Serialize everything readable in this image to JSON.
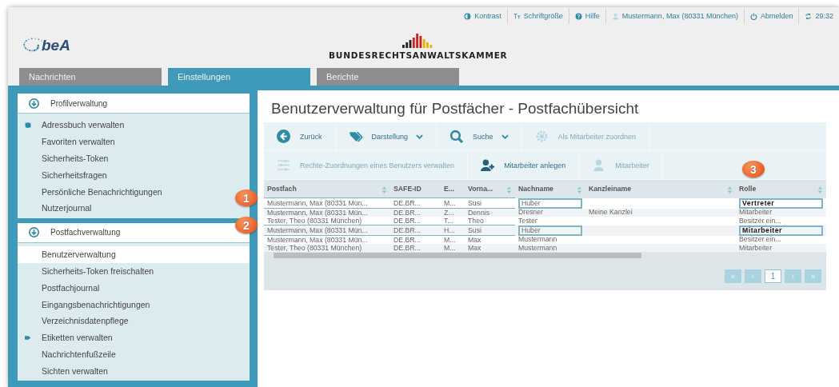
{
  "top_links": [
    {
      "kind": "contrast",
      "label": "Kontrast"
    },
    {
      "kind": "font",
      "label": "Schriftgröße"
    },
    {
      "kind": "help",
      "label": "Hilfe"
    },
    {
      "kind": "user",
      "label": "Mustermann, Max (80331 München)"
    },
    {
      "kind": "logout",
      "label": "Abmelden"
    },
    {
      "kind": "timer",
      "label": "29:32"
    }
  ],
  "logo": {
    "text": "beA"
  },
  "org": {
    "name": "BUNDESRECHTSANWALTSKAMMER"
  },
  "tabs": [
    {
      "label": "Nachrichten",
      "selected": false
    },
    {
      "label": "Einstellungen",
      "selected": true
    },
    {
      "label": "Berichte",
      "selected": false
    }
  ],
  "sidebar": [
    {
      "title": "Profilverwaltung",
      "items": [
        {
          "label": "Adressbuch verwalten",
          "kind": "book",
          "selected": false
        },
        {
          "label": "Favoriten verwalten",
          "selected": false
        },
        {
          "label": "Sicherheits-Token",
          "selected": false
        },
        {
          "label": "Sicherheitsfragen",
          "selected": false
        },
        {
          "label": "Persönliche Benachrichtigungen",
          "selected": false
        },
        {
          "label": "Nutzerjournal",
          "selected": false
        }
      ]
    },
    {
      "title": "Postfachverwaltung",
      "items": [
        {
          "label": "Benutzerverwaltung",
          "selected": true
        },
        {
          "label": "Sicherheits-Token freischalten",
          "selected": false
        },
        {
          "label": "Postfachjournal",
          "selected": false
        },
        {
          "label": "Eingangsbenachrichtigungen",
          "selected": false
        },
        {
          "label": "Verzeichnisdatenpflege",
          "selected": false
        },
        {
          "label": "Etiketten verwalten",
          "kind": "tag",
          "selected": false
        },
        {
          "label": "Nachrichtenfußzeile",
          "selected": false
        },
        {
          "label": "Sichten verwalten",
          "selected": false
        }
      ]
    }
  ],
  "page_title": "Benutzerverwaltung für Postfächer - Postfachübersicht",
  "toolbar": [
    [
      {
        "kind": "back",
        "label": "Zurück",
        "disabled": false,
        "dropdown": false
      },
      {
        "kind": "tags",
        "label": "Darstellung",
        "disabled": false,
        "dropdown": true
      },
      {
        "kind": "search",
        "label": "Suche",
        "disabled": false,
        "dropdown": true
      },
      {
        "kind": "gear",
        "label": "Als Mitarbeiter zuordnen",
        "disabled": true,
        "dropdown": false
      }
    ],
    [
      {
        "kind": "sliders",
        "label": "Rechte-Zuordnungen eines Benutzers verwalten",
        "disabled": true,
        "dropdown": false
      },
      {
        "kind": "user-add",
        "label": "Mitarbeiter anlegen",
        "disabled": false,
        "dropdown": false
      },
      {
        "kind": "user",
        "label": "Mitarbeiter",
        "disabled": true,
        "dropdown": false
      }
    ]
  ],
  "table": {
    "columns": [
      {
        "label": "Postfach",
        "sortable": true
      },
      {
        "label": "SAFE-ID",
        "sortable": false
      },
      {
        "label": "E...",
        "sortable": false
      },
      {
        "label": "Vorna...",
        "sortable": true
      },
      {
        "label": "Nachname",
        "sortable": true
      },
      {
        "label": "Kanzleiname",
        "sortable": true
      },
      {
        "label": "Rolle",
        "sortable": true,
        "callout": "3"
      }
    ],
    "rows": [
      {
        "cells": [
          "Mustermann, Max (80331 Mün...",
          "DE.BR...",
          "M...",
          "Susi",
          "Huber",
          "",
          "Vertreter"
        ],
        "marked": true,
        "callout": "1"
      },
      {
        "cells": [
          "Mustermann, Max (80331 Mün...",
          "DE.BR...",
          "Z...",
          "Dennis",
          "Dresner",
          "Meine Kanzlei",
          "Mitarbeiter"
        ],
        "marked": false
      },
      {
        "cells": [
          "Tester, Theo (80331 München)",
          "DE.BR...",
          "T...",
          "Theo",
          "Tester",
          "",
          "Besitzer ein..."
        ],
        "marked": false
      },
      {
        "cells": [
          "Mustermann, Max (80331 Mün...",
          "DE.BR...",
          "H...",
          "Susi",
          "Huber",
          "",
          "Mitarbeiter"
        ],
        "marked": true,
        "callout": "2"
      },
      {
        "cells": [
          "Mustermann, Max (80331 Mün...",
          "DE.BR...",
          "M...",
          "Max",
          "Mustermann",
          "",
          "Besitzer ein..."
        ],
        "marked": false
      },
      {
        "cells": [
          "Tester, Theo (80331 München)",
          "DE.BR...",
          "M...",
          "Max",
          "Mustermann",
          "",
          "Mitarbeiter"
        ],
        "marked": false
      }
    ]
  },
  "pagination": [
    {
      "label": "«",
      "selected": false
    },
    {
      "label": "‹",
      "selected": false
    },
    {
      "label": "1",
      "selected": true
    },
    {
      "label": "›",
      "selected": false
    },
    {
      "label": "»",
      "selected": false
    }
  ]
}
